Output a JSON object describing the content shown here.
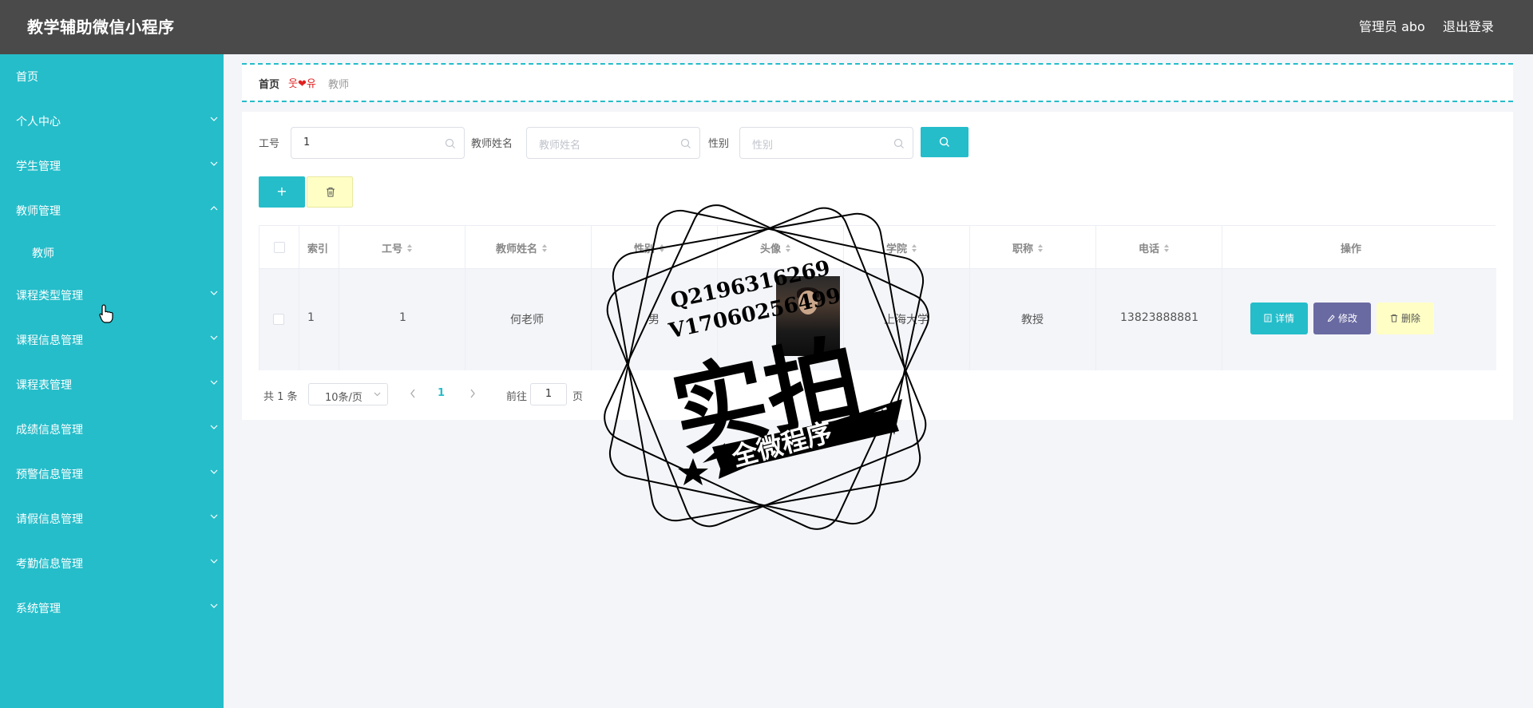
{
  "app": {
    "title": "教学辅助微信小程序",
    "admin": "管理员 abo",
    "logout": "退出登录"
  },
  "sidebar": {
    "items": [
      {
        "label": "首页"
      },
      {
        "label": "个人中心"
      },
      {
        "label": "学生管理"
      },
      {
        "label": "教师管理"
      },
      {
        "label": "教师"
      },
      {
        "label": "课程类型管理"
      },
      {
        "label": "课程信息管理"
      },
      {
        "label": "课程表管理"
      },
      {
        "label": "成绩信息管理"
      },
      {
        "label": "预警信息管理"
      },
      {
        "label": "请假信息管理"
      },
      {
        "label": "考勤信息管理"
      },
      {
        "label": "系统管理"
      }
    ]
  },
  "breadcrumb": {
    "home": "首页",
    "separator": "웃❤유",
    "current": "教师"
  },
  "filters": {
    "gonghao_label": "工号",
    "gonghao_value": "1",
    "name_label": "教师姓名",
    "name_placeholder": "教师姓名",
    "gender_label": "性别",
    "gender_placeholder": "性别"
  },
  "actions": {
    "add": "+"
  },
  "table": {
    "headers": [
      "索引",
      "工号",
      "教师姓名",
      "性别",
      "头像",
      "学院",
      "职称",
      "电话",
      "操作"
    ],
    "rows": [
      {
        "index": "1",
        "gonghao": "1",
        "name": "何老师",
        "gender": "男",
        "college": "上海大学",
        "title": "教授",
        "phone": "13823888881"
      }
    ],
    "ops": {
      "detail": "详情",
      "edit": "修改",
      "delete": "删除"
    }
  },
  "pagination": {
    "total": "共 1 条",
    "page_size": "10条/页",
    "current_page": "1",
    "goto_label": "前往",
    "goto_value": "1",
    "page_unit": "页"
  },
  "watermark": {
    "line1": "Q2196316269",
    "line2": "V17060256499",
    "big": "实拍",
    "ribbon": "全微程序"
  },
  "colors": {
    "accent": "#25bdca",
    "topbar": "#4a4a4a",
    "edit": "#6a6aa2",
    "delete": "#ffffc5"
  }
}
